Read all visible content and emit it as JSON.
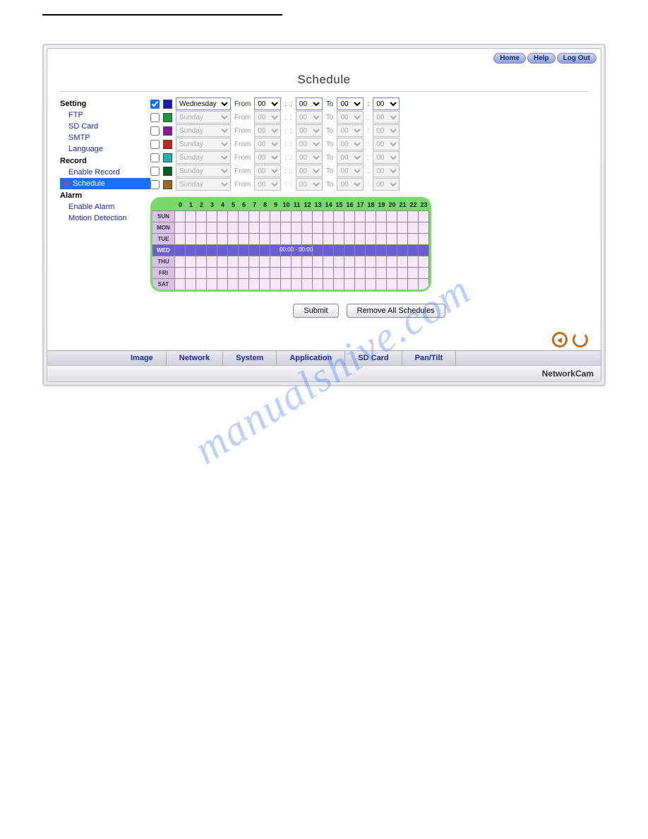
{
  "topbar": {
    "home": "Home",
    "help": "Help",
    "logout": "Log Out"
  },
  "title": "Schedule",
  "sidebar": {
    "groups": [
      {
        "label": "Setting",
        "items": [
          "FTP",
          "SD Card",
          "SMTP",
          "Language"
        ]
      },
      {
        "label": "Record",
        "items": [
          "Enable Record",
          "Schedule"
        ]
      },
      {
        "label": "Alarm",
        "items": [
          "Enable Alarm",
          "Motion Detection"
        ]
      }
    ]
  },
  "active_link": "Schedule",
  "rows": [
    {
      "checked": true,
      "color": "#1a1ab8",
      "day": "Wednesday",
      "from_h": "00",
      "from_m": "00",
      "to_h": "00",
      "to_m": "00",
      "enabled": true
    },
    {
      "checked": false,
      "color": "#1a9a3a",
      "day": "Sunday",
      "from_h": "00",
      "from_m": "00",
      "to_h": "00",
      "to_m": "00",
      "enabled": false
    },
    {
      "checked": false,
      "color": "#8a1a9a",
      "day": "Sunday",
      "from_h": "00",
      "from_m": "00",
      "to_h": "00",
      "to_m": "00",
      "enabled": false
    },
    {
      "checked": false,
      "color": "#c82020",
      "day": "Sunday",
      "from_h": "00",
      "from_m": "00",
      "to_h": "00",
      "to_m": "00",
      "enabled": false
    },
    {
      "checked": false,
      "color": "#1ab8b0",
      "day": "Sunday",
      "from_h": "00",
      "from_m": "00",
      "to_h": "00",
      "to_m": "00",
      "enabled": false
    },
    {
      "checked": false,
      "color": "#0a5a20",
      "day": "Sunday",
      "from_h": "00",
      "from_m": "00",
      "to_h": "00",
      "to_m": "00",
      "enabled": false
    },
    {
      "checked": false,
      "color": "#9a6a20",
      "day": "Sunday",
      "from_h": "00",
      "from_m": "00",
      "to_h": "00",
      "to_m": "00",
      "enabled": false
    }
  ],
  "labels": {
    "from": "From",
    "to": "To",
    "colon": ":"
  },
  "hours": [
    "0",
    "1",
    "2",
    "3",
    "4",
    "5",
    "6",
    "7",
    "8",
    "9",
    "10",
    "11",
    "12",
    "13",
    "14",
    "15",
    "16",
    "17",
    "18",
    "19",
    "20",
    "21",
    "22",
    "23"
  ],
  "days": [
    "SUN",
    "MON",
    "TUE",
    "WED",
    "THU",
    "FRI",
    "SAT"
  ],
  "filled_day": "WED",
  "filled_text": "00:00 - 00:00",
  "buttons": {
    "submit": "Submit",
    "remove": "Remove All Schedules"
  },
  "tabs": [
    "Image",
    "Network",
    "System",
    "Application",
    "SD Card",
    "Pan/Tilt"
  ],
  "brand": "NetworkCam",
  "watermark": "manualshive.com"
}
